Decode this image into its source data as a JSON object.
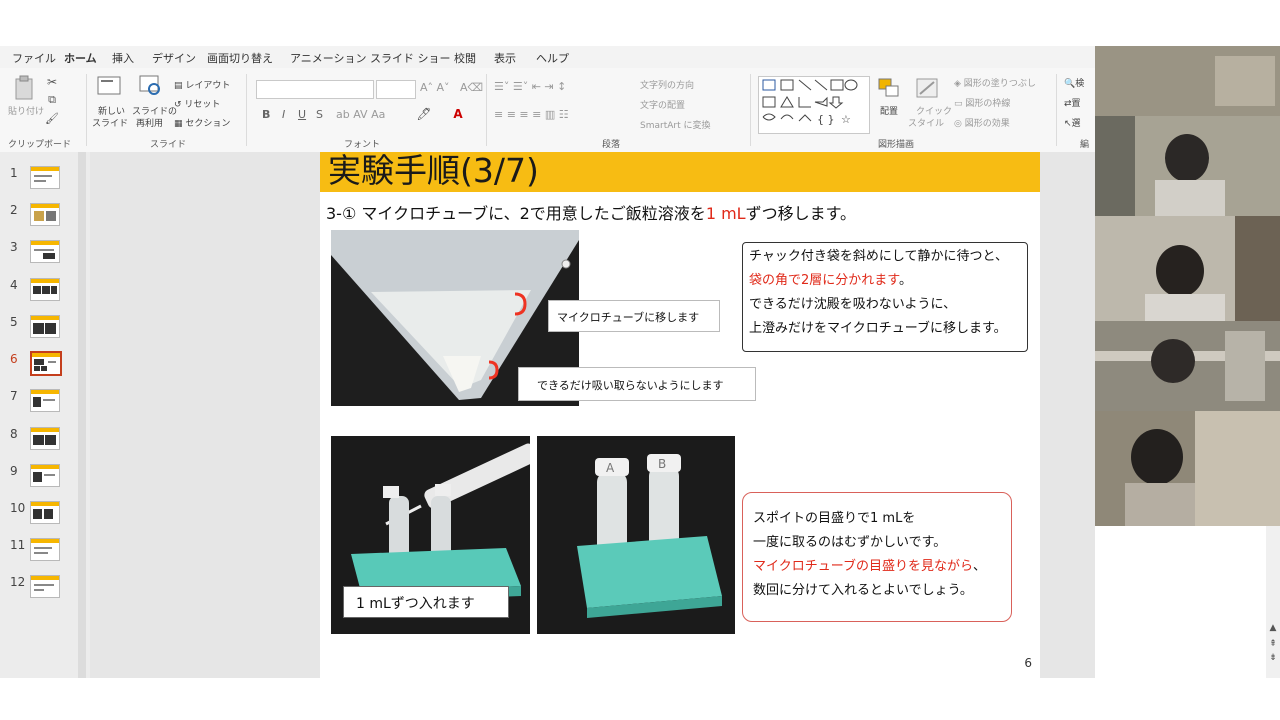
{
  "ribbon": {
    "tabs": [
      "ファイル",
      "ホーム",
      "挿入",
      "デザイン",
      "画面切り替え",
      "アニメーション",
      "スライド ショー",
      "校閲",
      "表示",
      "ヘルプ"
    ],
    "active_tab": "ホーム",
    "clipboard": {
      "paste": "貼り付け",
      "group": "クリップボード"
    },
    "slides": {
      "new_slide": "新しい",
      "new_slide2": "スライド",
      "reuse": "スライドの",
      "reuse2": "再利用",
      "layout": "レイアウト",
      "reset": "リセット",
      "section": "セクション",
      "group": "スライド"
    },
    "font": {
      "group": "フォント",
      "bold": "B",
      "italic": "I",
      "underline": "U",
      "strike": "S"
    },
    "paragraph": {
      "text_dir": "文字列の方向",
      "align": "文字の配置",
      "smartart": "SmartArt に変換",
      "group": "段落"
    },
    "drawing": {
      "arrange": "配置",
      "quick1": "クイック",
      "quick2": "スタイル",
      "fill": "図形の塗りつぶし",
      "outline": "図形の枠線",
      "effects": "図形の効果",
      "group": "図形描画"
    },
    "editing": {
      "find": "検",
      "replace": "置",
      "select": "選",
      "group": "編"
    }
  },
  "thumbnails": {
    "numbers": [
      "1",
      "2",
      "3",
      "4",
      "5",
      "6",
      "7",
      "8",
      "9",
      "10",
      "11",
      "12"
    ],
    "selected": "6"
  },
  "slide": {
    "title": "実験手順(3/7)",
    "heading_pre": "3-① マイクロチューブに、2で用意したご飯粒溶液を",
    "heading_red": "1 mL",
    "heading_post": "ずつ移します。",
    "callout_upper": "マイクロチューブに移します",
    "callout_lower": "できるだけ吸い取らないようにします",
    "note1": {
      "line1": "チャック付き袋を斜めにして静かに待つと、",
      "line2_red": "袋の角で2層に分かれます",
      "line2_post": "。",
      "line3": "できるだけ沈殿を吸わないように、",
      "line4": "上澄みだけをマイクロチューブに移します。"
    },
    "photo_caption": "1 mLずつ入れます",
    "note2": {
      "line1": "スポイトの目盛りで1 mLを",
      "line2": "一度に取るのはむずかしいです。",
      "line3_red": "マイクロチューブの目盛りを見ながら",
      "line3_post": "、",
      "line4": "数回に分けて入れるとよいでしょう。"
    },
    "page_number": "6"
  },
  "colors": {
    "title_bar": "#f7bc13",
    "accent_red": "#e02a1a",
    "ribbon_active": "#c43e1c"
  }
}
